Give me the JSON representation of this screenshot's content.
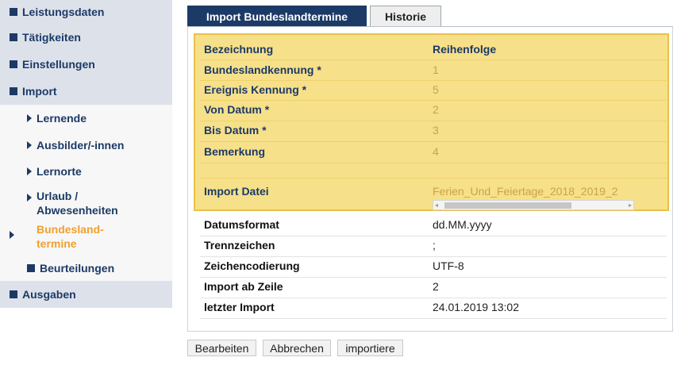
{
  "sidebar": {
    "main_items": [
      {
        "label": "Leistungsdaten"
      },
      {
        "label": "Tätigkeiten"
      },
      {
        "label": "Einstellungen"
      },
      {
        "label": "Import"
      },
      {
        "label": "Ausgaben"
      }
    ],
    "import_sub_items": [
      {
        "label": "Lernende"
      },
      {
        "label": "Ausbilder/-innen"
      },
      {
        "label": "Lernorte"
      },
      {
        "label": "Urlaub / Abwesenheiten",
        "line1": "Urlaub /",
        "line2": "Abwesenheiten"
      },
      {
        "label": "Bundesland-termine",
        "line1": "Bundesland-",
        "line2": "termine",
        "active": true
      },
      {
        "label": "Beurteilungen"
      }
    ]
  },
  "tabs": [
    {
      "label": "Import Bundeslandtermine",
      "active": true
    },
    {
      "label": "Historie",
      "active": false
    }
  ],
  "mapping": {
    "header": {
      "key": "Bezeichnung",
      "value": "Reihenfolge"
    },
    "rows": [
      {
        "key": "Bundeslandkennung *",
        "value": "1"
      },
      {
        "key": "Ereignis Kennung *",
        "value": "5"
      },
      {
        "key": "Von Datum *",
        "value": "2"
      },
      {
        "key": "Bis Datum *",
        "value": "3"
      },
      {
        "key": "Bemerkung",
        "value": "4"
      }
    ],
    "import_file": {
      "key": "Import Datei",
      "value": "Ferien_Und_Feiertage_2018_2019_2"
    }
  },
  "settings": [
    {
      "key": "Datumsformat",
      "value": "dd.MM.yyyy"
    },
    {
      "key": "Trennzeichen",
      "value": ";"
    },
    {
      "key": "Zeichencodierung",
      "value": "UTF-8"
    },
    {
      "key": "Import ab Zeile",
      "value": "2"
    },
    {
      "key": "letzter Import",
      "value": "24.01.2019 13:02"
    }
  ],
  "buttons": {
    "edit": "Bearbeiten",
    "cancel": "Abbrechen",
    "import": "importiere"
  },
  "colors": {
    "nav_blue": "#1c3a66",
    "highlight": "#f6e08a",
    "active_orange": "#f0a030"
  },
  "icons": {
    "nav_bullet": "square-bullet-icon",
    "sub_arrow": "triangle-right-icon",
    "scroll_left": "scroll-left-arrow-icon",
    "scroll_right": "scroll-right-arrow-icon"
  }
}
